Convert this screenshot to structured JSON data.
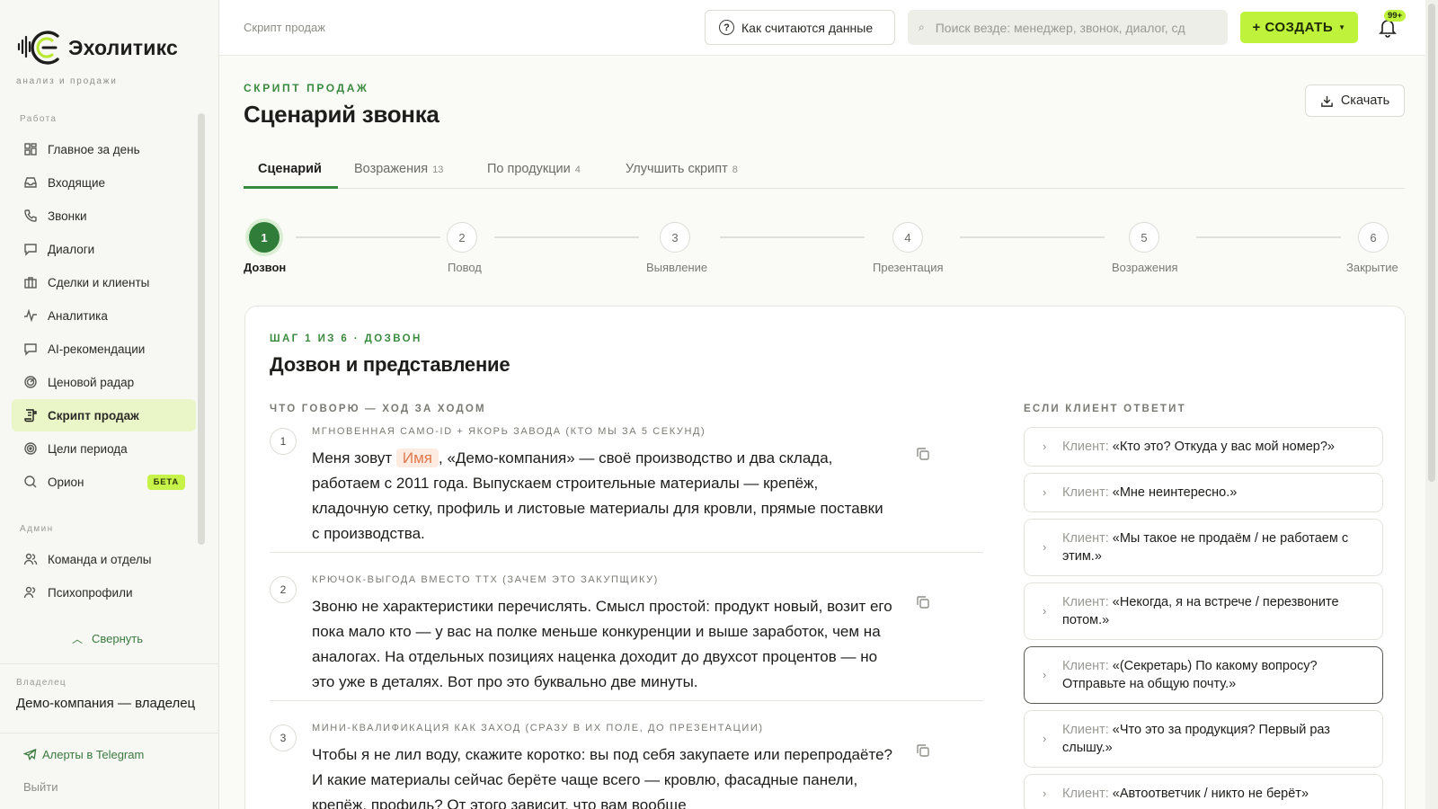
{
  "app": {
    "name": "Эхолитикс",
    "tagline": "анализ и продажи"
  },
  "sidebar": {
    "section_work": "Работа",
    "section_admin": "Админ",
    "items": [
      {
        "label": "Главное за день",
        "icon": "dashboard-icon"
      },
      {
        "label": "Входящие",
        "icon": "inbox-icon"
      },
      {
        "label": "Звонки",
        "icon": "phone-icon"
      },
      {
        "label": "Диалоги",
        "icon": "chat-icon"
      },
      {
        "label": "Сделки и клиенты",
        "icon": "briefcase-icon"
      },
      {
        "label": "Аналитика",
        "icon": "activity-icon"
      },
      {
        "label": "AI-рекомендации",
        "icon": "ai-chat-icon"
      },
      {
        "label": "Ценовой радар",
        "icon": "radar-icon"
      },
      {
        "label": "Скрипт продаж",
        "icon": "script-icon",
        "active": true
      },
      {
        "label": "Цели периода",
        "icon": "target-icon"
      },
      {
        "label": "Орион",
        "icon": "search-icon",
        "badge": "БЕТА"
      }
    ],
    "admin_items": [
      {
        "label": "Команда и отделы",
        "icon": "team-icon"
      },
      {
        "label": "Психопрофили",
        "icon": "profile-icon"
      }
    ],
    "collapse_label": "Свернуть",
    "owner_label": "Владелец",
    "owner_name": "Демо-компания — владелец",
    "telegram_label": "Алерты в Telegram",
    "logout_label": "Выйти"
  },
  "header": {
    "breadcrumb": "Скрипт продаж",
    "how_label": "Как считаются данные",
    "search_placeholder": "Поиск везде: менеджер, звонок, диалог, сд",
    "create_label": "+ СОЗДАТЬ",
    "notifications_count": "99+"
  },
  "page": {
    "eyebrow": "СКРИПТ ПРОДАЖ",
    "title": "Сценарий звонка",
    "download_label": "Скачать"
  },
  "tabs": [
    {
      "label": "Сценарий",
      "count": ""
    },
    {
      "label": "Возражения",
      "count": "13"
    },
    {
      "label": "По продукции",
      "count": "4"
    },
    {
      "label": "Улучшить скрипт",
      "count": "8"
    }
  ],
  "steps": [
    {
      "num": "1",
      "label": "Дозвон"
    },
    {
      "num": "2",
      "label": "Повод"
    },
    {
      "num": "3",
      "label": "Выявление"
    },
    {
      "num": "4",
      "label": "Презентация"
    },
    {
      "num": "5",
      "label": "Возражения"
    },
    {
      "num": "6",
      "label": "Закрытие"
    }
  ],
  "step_card": {
    "eyebrow": "ШАГ 1 ИЗ 6 · ДОЗВОН",
    "title": "Дозвон и представление",
    "left_heading": "ЧТО ГОВОРЮ — ХОД ЗА ХОДОМ",
    "right_heading": "ЕСЛИ КЛИЕНТ ОТВЕТИТ",
    "moves": [
      {
        "num": "1",
        "kicker": "МГНОВЕННАЯ САМО-ID + ЯКОРЬ ЗАВОДА (КТО МЫ ЗА 5 СЕКУНД)",
        "text_before": "Меня зовут",
        "name_chip": "Имя",
        "text_after": ", «Демо-компания» — своё производство и два склада, работаем с 2011 года. Выпускаем строительные материалы — крепёж, кладочную сетку, профиль и листовые материалы для кровли, прямые поставки с производства."
      },
      {
        "num": "2",
        "kicker": "КРЮЧОК-ВЫГОДА ВМЕСТО ТТХ (ЗАЧЕМ ЭТО ЗАКУПЩИКУ)",
        "text": "Звоню не характеристики перечислять. Смысл простой: продукт новый, возит его пока мало кто — у вас на полке меньше конкуренции и выше заработок, чем на аналогах. На отдельных позициях наценка доходит до двухсот процентов — но это уже в деталях. Вот про это буквально две минуты."
      },
      {
        "num": "3",
        "kicker": "МИНИ-КВАЛИФИКАЦИЯ КАК ЗАХОД (СРАЗУ В ИХ ПОЛЕ, ДО ПРЕЗЕНТАЦИИ)",
        "text": "Чтобы я не лил воду, скажите коротко: вы под себя закупаете или перепродаёте? И какие материалы сейчас берёте чаще всего — кровлю, фасадные панели, крепёж, профиль? От этого зависит, что вам вообще"
      }
    ],
    "client_prefix": "Клиент:",
    "replies": [
      "«Кто это? Откуда у вас мой номер?»",
      "«Мне неинтересно.»",
      "«Мы такое не продаём / не работаем с этим.»",
      "«Некогда, я на встрече / перезвоните потом.»",
      "«(Секретарь) По какому вопросу? Отправьте на общую почту.»",
      "«Что это за продукция? Первый раз слышу.»",
      "«Автоответчик / никто не берёт»"
    ]
  },
  "colors": {
    "accent_green": "#3a8a3e",
    "lime": "#bff23a",
    "active_nav_bg": "#eaf6c8"
  }
}
